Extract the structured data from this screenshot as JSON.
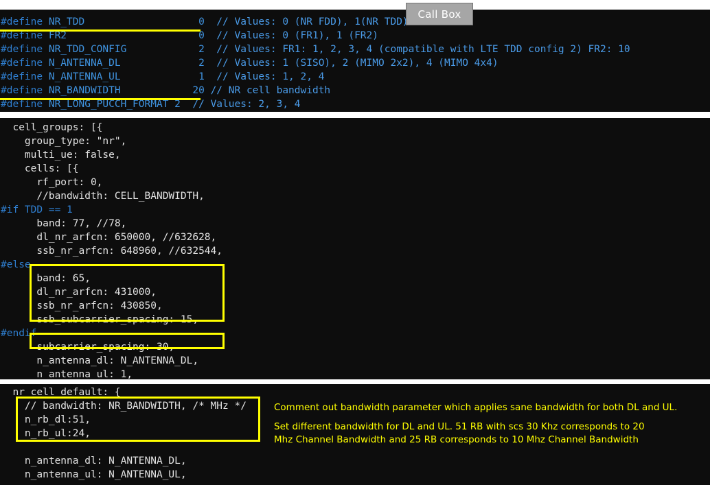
{
  "call_box": {
    "label": "Call Box"
  },
  "panels": {
    "defines": {
      "lines": [
        {
          "directive": "#define",
          "name": " NR_TDD",
          "pad": "                   ",
          "value": "0",
          "gap": "  ",
          "comment": "// Values: 0 (NR FDD), 1(NR TDD)"
        },
        {
          "directive": "#define",
          "name": " FR2",
          "pad": "                      ",
          "value": "0",
          "gap": "  ",
          "comment": "// Values: 0 (FR1), 1 (FR2)"
        },
        {
          "directive": "#define",
          "name": " NR_TDD_CONFIG",
          "pad": "            ",
          "value": "2",
          "gap": "  ",
          "comment": "// Values: FR1: 1, 2, 3, 4 (compatible with LTE TDD config 2) FR2: 10"
        },
        {
          "directive": "#define",
          "name": " N_ANTENNA_DL",
          "pad": "             ",
          "value": "2",
          "gap": "  ",
          "comment": "// Values: 1 (SISO), 2 (MIMO 2x2), 4 (MIMO 4x4)"
        },
        {
          "directive": "#define",
          "name": " N_ANTENNA_UL",
          "pad": "             ",
          "value": "1",
          "gap": "  ",
          "comment": "// Values: 1, 2, 4"
        },
        {
          "directive": "#define",
          "name": " NR_BANDWIDTH",
          "pad": "            ",
          "value": "20",
          "gap": " ",
          "comment": "// NR cell bandwidth"
        },
        {
          "directive": "#define",
          "name": " NR_LONG_PUCCH_FORMAT",
          "pad": " ",
          "value": "2",
          "gap": "  ",
          "comment": "// Values: 2, 3, 4"
        }
      ]
    },
    "cells": {
      "lines": [
        {
          "kind": "code",
          "text": "  cell_groups: [{"
        },
        {
          "kind": "code",
          "text": "    group_type: \"nr\","
        },
        {
          "kind": "code",
          "text": "    multi_ue: false,"
        },
        {
          "kind": "code",
          "text": "    cells: [{"
        },
        {
          "kind": "code",
          "text": "      rf_port: 0,"
        },
        {
          "kind": "code",
          "text": "      //bandwidth: CELL_BANDWIDTH,"
        },
        {
          "kind": "pp",
          "text": "#if TDD == 1"
        },
        {
          "kind": "code",
          "text": "      band: 77, //78,"
        },
        {
          "kind": "code",
          "text": "      dl_nr_arfcn: 650000, //632628,"
        },
        {
          "kind": "code",
          "text": "      ssb_nr_arfcn: 648960, //632544,"
        },
        {
          "kind": "pp",
          "text": "#else"
        },
        {
          "kind": "code",
          "text": "      band: 65,"
        },
        {
          "kind": "code",
          "text": "      dl_nr_arfcn: 431000,"
        },
        {
          "kind": "code",
          "text": "      ssb_nr_arfcn: 430850,"
        },
        {
          "kind": "code",
          "text": "      ssb_subcarrier_spacing: 15,"
        },
        {
          "kind": "pp",
          "text": "#endif"
        },
        {
          "kind": "code",
          "text": "      subcarrier_spacing: 30,"
        },
        {
          "kind": "code",
          "text": "      n_antenna_dl: N_ANTENNA_DL,"
        },
        {
          "kind": "code",
          "text": "      n_antenna_ul: 1,"
        }
      ]
    },
    "nr_cell_default": {
      "lines": [
        {
          "kind": "code",
          "text": "  nr_cell_default: {"
        },
        {
          "kind": "code",
          "text": "    // bandwidth: NR_BANDWIDTH, /* MHz */"
        },
        {
          "kind": "code",
          "text": "    n_rb_dl:51,"
        },
        {
          "kind": "code",
          "text": "    n_rb_ul:24,"
        },
        {
          "kind": "code",
          "text": ""
        },
        {
          "kind": "code",
          "text": "    n_antenna_dl: N_ANTENNA_DL,"
        },
        {
          "kind": "code",
          "text": "    n_antenna_ul: N_ANTENNA_UL,"
        }
      ]
    }
  },
  "annotations": {
    "comment_out": "Comment out bandwidth parameter which applies sane bandwidth for both DL and UL.",
    "set_different": "Set different bandwidth for DL and UL. 51 RB with scs 30 Khz corresponds to 20\nMhz Channel Bandwidth and 25 RB corresponds to 10 Mhz Channel Bandwidth"
  },
  "colors": {
    "highlight_yellow": "#ffff00",
    "terminal_bg": "#0d0d0d",
    "preprocessor_blue": "#2f7fd1",
    "comment_blue": "#4a9be8",
    "code_white": "#e3e3e3",
    "call_box_bg": "#a6a6a6"
  }
}
